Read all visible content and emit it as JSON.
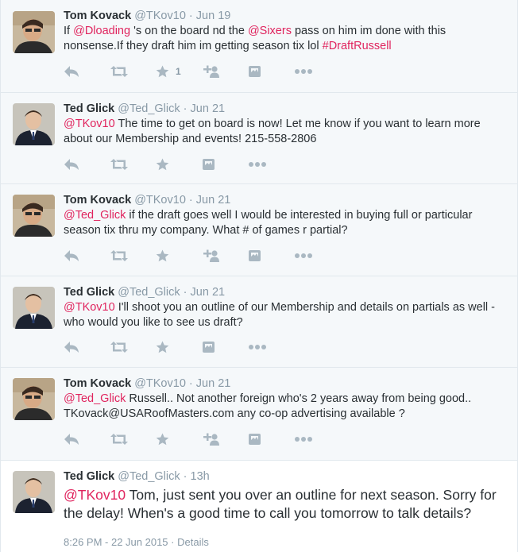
{
  "tweets": [
    {
      "name": "Tom Kovack",
      "handle": "@TKov10",
      "sep": "·",
      "time": "Jun 19",
      "avatar": "tom-avatar",
      "segments": [
        {
          "t": "If ",
          "k": "plain"
        },
        {
          "t": "@Dloading",
          "k": "ment"
        },
        {
          "t": " 's on the board nd the ",
          "k": "plain"
        },
        {
          "t": "@Sixers",
          "k": "ment"
        },
        {
          "t": " pass on him im done with this nonsense.If they draft him im getting season tix lol ",
          "k": "plain"
        },
        {
          "t": "#DraftRussell",
          "k": "hash"
        }
      ],
      "fav_count": "1"
    },
    {
      "name": "Ted Glick",
      "handle": "@Ted_Glick",
      "sep": "·",
      "time": "Jun 21",
      "avatar": "ted-avatar",
      "segments": [
        {
          "t": "@TKov10",
          "k": "ment"
        },
        {
          "t": " The time to get on board is now! Let me know if you want to learn more about our Membership and events! 215-558-2806",
          "k": "plain"
        }
      ],
      "fav_count": ""
    },
    {
      "name": "Tom Kovack",
      "handle": "@TKov10",
      "sep": "·",
      "time": "Jun 21",
      "avatar": "tom-avatar",
      "segments": [
        {
          "t": "@Ted_Glick",
          "k": "ment"
        },
        {
          "t": " if the draft goes well I would be interested in buying full or particular season tix thru my company. What # of games r partial?",
          "k": "plain"
        }
      ],
      "fav_count": ""
    },
    {
      "name": "Ted Glick",
      "handle": "@Ted_Glick",
      "sep": "·",
      "time": "Jun 21",
      "avatar": "ted-avatar",
      "segments": [
        {
          "t": "@TKov10",
          "k": "ment"
        },
        {
          "t": " I'll shoot you an outline of our Membership and details on partials as well - who would you like to see us draft?",
          "k": "plain"
        }
      ],
      "fav_count": ""
    },
    {
      "name": "Tom Kovack",
      "handle": "@TKov10",
      "sep": "·",
      "time": "Jun 21",
      "avatar": "tom-avatar",
      "segments": [
        {
          "t": "@Ted_Glick",
          "k": "ment"
        },
        {
          "t": " Russell.. Not another foreign who's 2 years away from being good.. TKovack@USARoofMasters.com any co-op advertising available ?",
          "k": "plain"
        }
      ],
      "fav_count": ""
    }
  ],
  "open_tweet": {
    "name": "Ted Glick",
    "handle": "@Ted_Glick",
    "sep": "·",
    "time": "13h",
    "avatar": "ted-avatar",
    "segments": [
      {
        "t": "@TKov10",
        "k": "ment"
      },
      {
        "t": " Tom, just sent you over an outline for next season. Sorry for the delay! When's a good time to call you tomorrow to talk details?",
        "k": "plain"
      }
    ],
    "timestamp": "8:26 PM - 22 Jun 2015",
    "meta_sep": "·",
    "details_label": "Details"
  },
  "icons": [
    "reply-icon",
    "retweet-icon",
    "favorite-icon",
    "follow-icon",
    "tweetdeck-icon",
    "more-icon"
  ],
  "colors": {
    "mention": "#e0245e",
    "muted": "#8899a6",
    "icon": "#aab8c2",
    "bg": "#f5f8fa"
  }
}
